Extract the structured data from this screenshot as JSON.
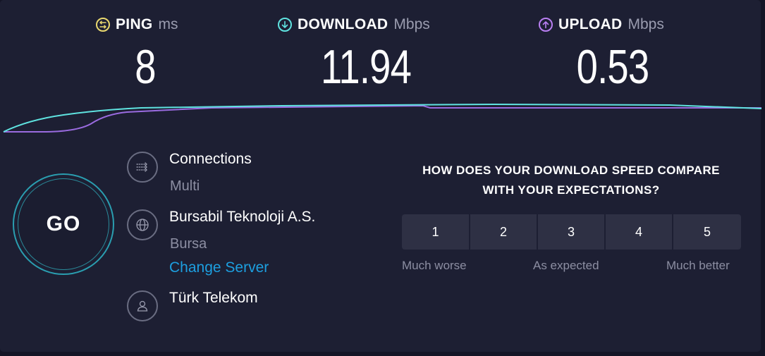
{
  "metrics": {
    "ping": {
      "label": "PING",
      "unit": "ms",
      "value": "8"
    },
    "download": {
      "label": "DOWNLOAD",
      "unit": "Mbps",
      "value": "11.94"
    },
    "upload": {
      "label": "UPLOAD",
      "unit": "Mbps",
      "value": "0.53"
    }
  },
  "go_label": "GO",
  "connections": {
    "title": "Connections",
    "mode": "Multi"
  },
  "server": {
    "name": "Bursabil Teknoloji A.S.",
    "location": "Bursa",
    "change_label": "Change Server"
  },
  "isp": {
    "name": "Türk Telekom"
  },
  "survey": {
    "question_line1": "HOW DOES YOUR DOWNLOAD SPEED COMPARE",
    "question_line2": "WITH YOUR EXPECTATIONS?",
    "options": [
      "1",
      "2",
      "3",
      "4",
      "5"
    ],
    "low_label": "Much worse",
    "mid_label": "As expected",
    "high_label": "Much better"
  },
  "colors": {
    "ping_accent": "#e9d86f",
    "download_accent": "#5fe3e0",
    "upload_accent": "#b97ff2",
    "link": "#1d9fe0"
  }
}
